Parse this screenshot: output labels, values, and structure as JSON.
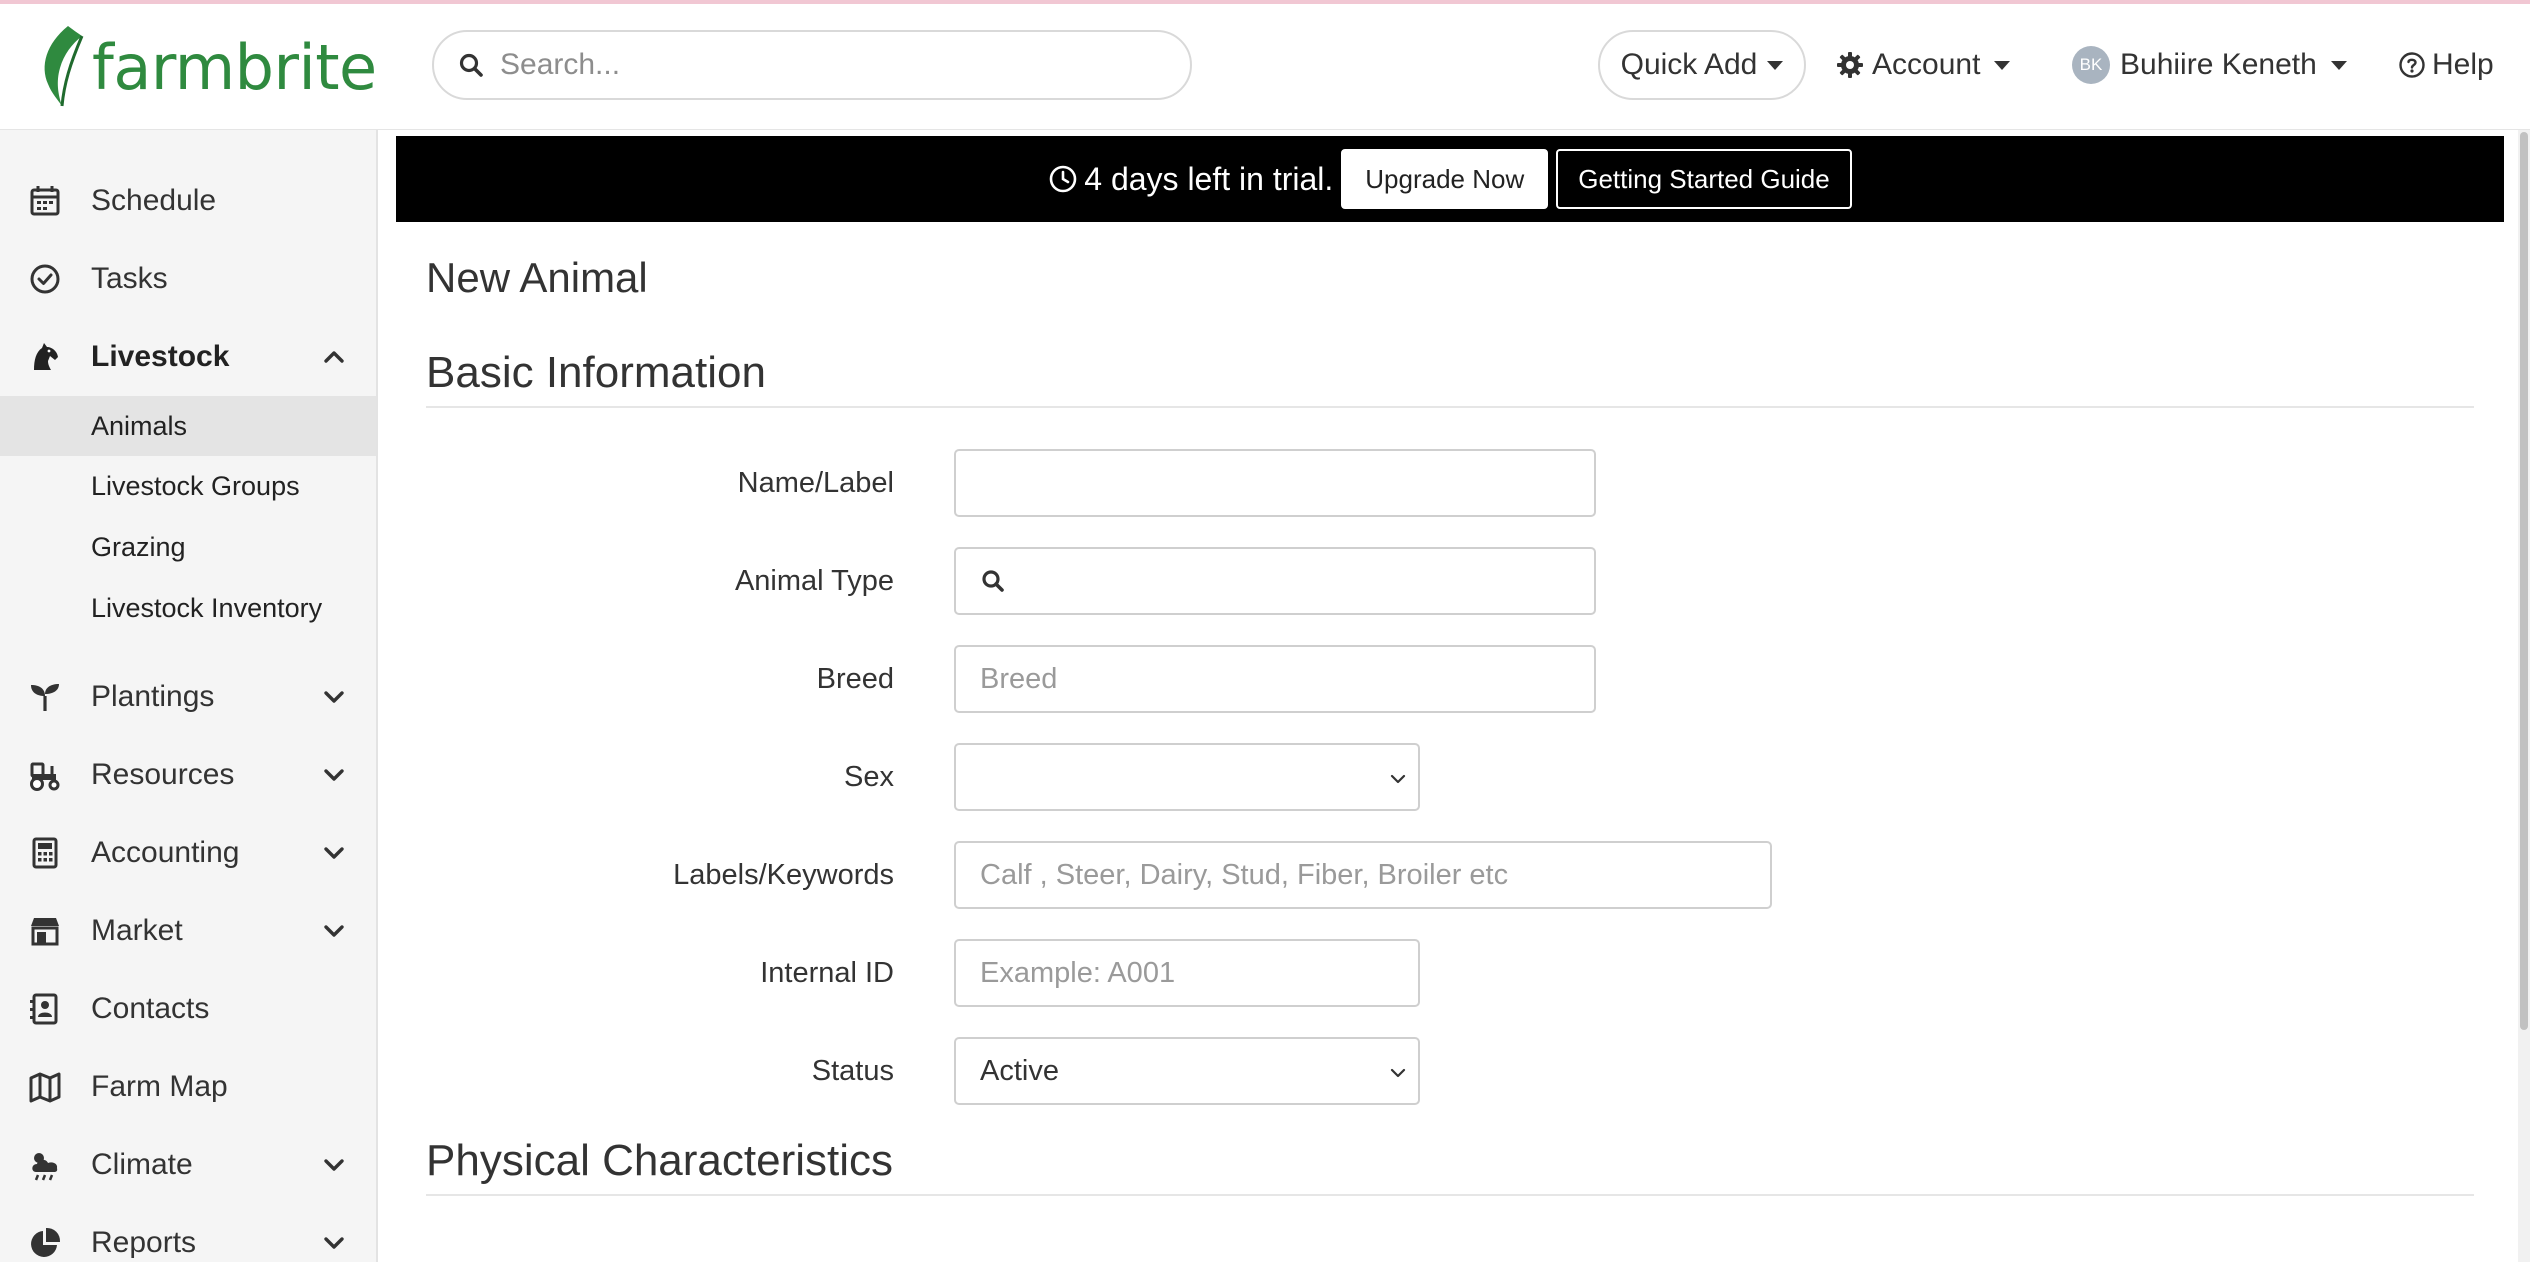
{
  "app": {
    "logo_text_farm": "farm",
    "logo_text_brite": "brite",
    "brand_color": "#2f8a3f"
  },
  "header": {
    "search_placeholder": "Search...",
    "quick_add_label": "Quick Add",
    "account_label": "Account",
    "user_initials": "BK",
    "user_name": "Buhiire Keneth",
    "help_label": "Help"
  },
  "sidebar": {
    "items": [
      {
        "label": "Schedule",
        "icon": "calendar-icon"
      },
      {
        "label": "Tasks",
        "icon": "check-circle-icon"
      },
      {
        "label": "Livestock",
        "icon": "horse-icon",
        "expanded": true
      },
      {
        "label": "Plantings",
        "icon": "seedling-icon"
      },
      {
        "label": "Resources",
        "icon": "tractor-icon"
      },
      {
        "label": "Accounting",
        "icon": "calculator-icon"
      },
      {
        "label": "Market",
        "icon": "store-icon"
      },
      {
        "label": "Contacts",
        "icon": "address-book-icon"
      },
      {
        "label": "Farm Map",
        "icon": "map-icon"
      },
      {
        "label": "Climate",
        "icon": "cloud-sun-rain-icon"
      },
      {
        "label": "Reports",
        "icon": "chart-pie-icon"
      }
    ],
    "livestock_sub": [
      {
        "label": "Animals",
        "selected": true
      },
      {
        "label": "Livestock Groups"
      },
      {
        "label": "Grazing"
      },
      {
        "label": "Livestock Inventory"
      }
    ]
  },
  "trial": {
    "text": "4 days left in trial.",
    "upgrade_label": "Upgrade Now",
    "guide_label": "Getting Started Guide"
  },
  "main": {
    "page_title": "New Animal",
    "section_basic": "Basic Information",
    "section_physical": "Physical Characteristics",
    "fields": {
      "name_label": "Name/Label",
      "name_value": "",
      "type_label": "Animal Type",
      "type_value": "",
      "breed_label": "Breed",
      "breed_placeholder": "Breed",
      "sex_label": "Sex",
      "sex_value": "",
      "keywords_label": "Labels/Keywords",
      "keywords_placeholder": "Calf , Steer, Dairy, Stud, Fiber, Broiler etc",
      "internal_id_label": "Internal ID",
      "internal_id_placeholder": "Example: A001",
      "status_label": "Status",
      "status_value": "Active"
    }
  }
}
